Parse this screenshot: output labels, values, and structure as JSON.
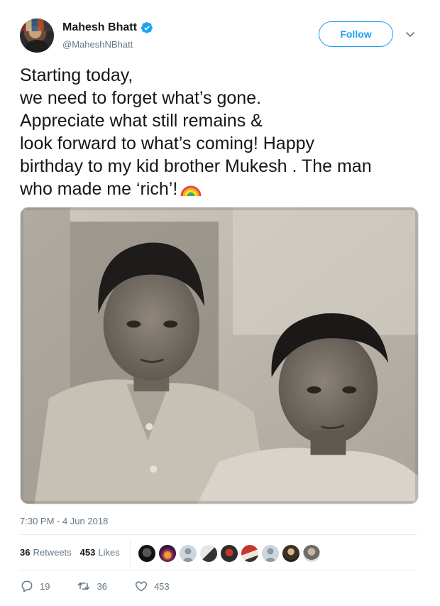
{
  "author": {
    "display_name": "Mahesh Bhatt",
    "handle": "@MaheshNBhatt",
    "verified": true
  },
  "follow_button": {
    "label": "Follow"
  },
  "tweet": {
    "lines": [
      "Starting today,",
      "we need to forget what’s gone.",
      "Appreciate what still remains &",
      "look forward to what’s coming!  Happy",
      "birthday to my kid brother Mukesh . The man",
      "who made me ‘rich’!"
    ],
    "emoji": "rainbow"
  },
  "timestamp": "7:30 PM - 4 Jun 2018",
  "stats": {
    "retweets_count": "36",
    "retweets_label": "Retweets",
    "likes_count": "453",
    "likes_label": "Likes"
  },
  "actions": {
    "replies": "19",
    "retweets": "36",
    "likes": "453"
  },
  "colors": {
    "accent": "#1da1f2",
    "text": "#14171a",
    "muted": "#657786",
    "divider": "#e6ecf0"
  },
  "icons": [
    "verified-badge-icon",
    "chevron-down-icon",
    "rainbow-emoji",
    "reply-icon",
    "retweet-icon",
    "like-icon"
  ]
}
